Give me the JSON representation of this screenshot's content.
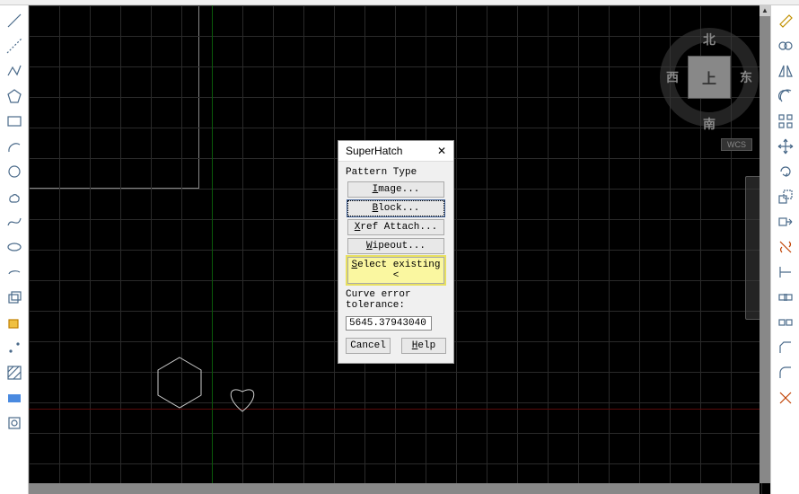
{
  "dialog": {
    "title": "SuperHatch",
    "section_label": "Pattern Type",
    "buttons": {
      "image": "Image...",
      "block": "Block...",
      "xref": "Xref Attach...",
      "wipeout": "Wipeout...",
      "select": "Select existing <"
    },
    "tolerance_label": "Curve error tolerance:",
    "tolerance_value": "5645.37943040",
    "cancel": "Cancel",
    "help": "Help"
  },
  "viewcube": {
    "north": "北",
    "south": "南",
    "west": "西",
    "east": "东",
    "face": "上",
    "wcs": "WCS"
  },
  "left_tools": [
    "line",
    "construction-line",
    "polyline",
    "polygon",
    "rectangle",
    "arc",
    "circle",
    "revision-cloud",
    "spline",
    "ellipse",
    "ellipse-arc",
    "insert-block",
    "make-block",
    "point",
    "hatch",
    "gradient",
    "region"
  ],
  "right_tools": [
    "erase",
    "copy",
    "mirror",
    "offset",
    "array",
    "move",
    "rotate",
    "scale",
    "stretch",
    "trim",
    "extend",
    "break",
    "join",
    "chamfer",
    "fillet",
    "explode"
  ]
}
